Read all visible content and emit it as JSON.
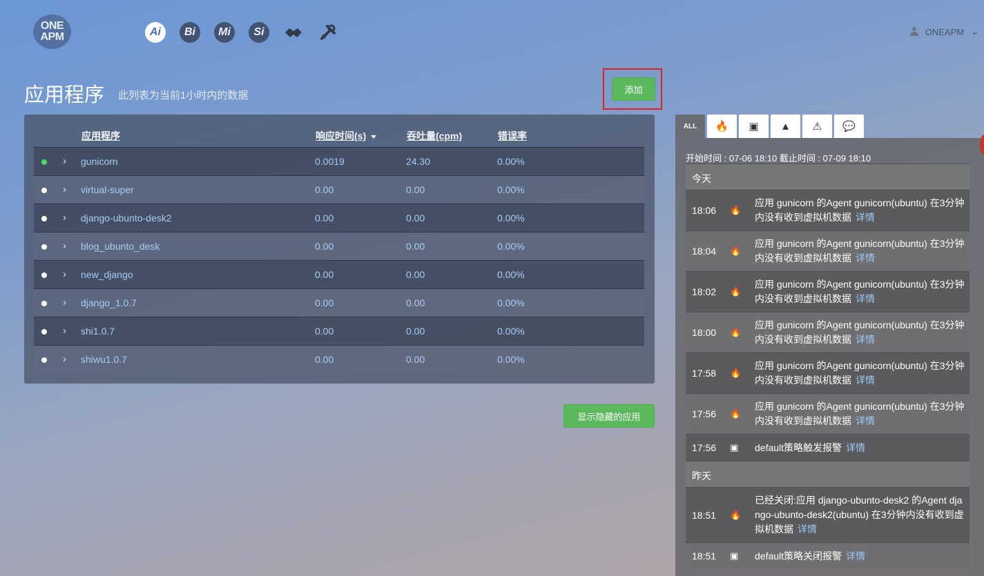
{
  "nav": {
    "logo_line1": "ONE",
    "logo_line2": "APM",
    "products": [
      {
        "label": "Ai",
        "icon": "ai-icon"
      },
      {
        "label": "Bi",
        "icon": "bi-icon"
      },
      {
        "label": "Mi",
        "icon": "mi-icon"
      },
      {
        "label": "Si",
        "icon": "si-icon"
      }
    ],
    "user_name": "ONEAPM"
  },
  "page": {
    "title": "应用程序",
    "subtitle": "此列表为当前1小时内的数据",
    "add_button": "添加",
    "show_hidden_button": "显示隐藏的应用"
  },
  "table": {
    "headers": {
      "name": "应用程序",
      "response": "响应时间(s)",
      "throughput": "吞吐量(cpm)",
      "error": "错误率"
    },
    "rows": [
      {
        "name": "gunicorn",
        "response": "0.0019",
        "throughput": "24.30",
        "error": "0.00%",
        "status": "green"
      },
      {
        "name": "virtual-super",
        "response": "0.00",
        "throughput": "0.00",
        "error": "0.00%",
        "status": "white"
      },
      {
        "name": "django-ubunto-desk2",
        "response": "0.00",
        "throughput": "0.00",
        "error": "0.00%",
        "status": "white"
      },
      {
        "name": "blog_ubunto_desk",
        "response": "0.00",
        "throughput": "0.00",
        "error": "0.00%",
        "status": "white"
      },
      {
        "name": "new_django",
        "response": "0.00",
        "throughput": "0.00",
        "error": "0.00%",
        "status": "white"
      },
      {
        "name": "django_1.0.7",
        "response": "0.00",
        "throughput": "0.00",
        "error": "0.00%",
        "status": "white"
      },
      {
        "name": "shi1.0.7",
        "response": "0.00",
        "throughput": "0.00",
        "error": "0.00%",
        "status": "white"
      },
      {
        "name": "shiwu1.0.7",
        "response": "0.00",
        "throughput": "0.00",
        "error": "0.00%",
        "status": "white"
      }
    ]
  },
  "alerts": {
    "tabs": [
      "ALL"
    ],
    "range_text": "开始时间 : 07-06 18:10 截止时间 : 07-09 18:10",
    "today_label": "今天",
    "yesterday_label": "昨天",
    "detail_label": "详情",
    "today": [
      {
        "time": "18:06",
        "icon": "fire-icon",
        "message": "应用 gunicorn 的Agent gunicorn(ubuntu) 在3分钟内没有收到虚拟机数据"
      },
      {
        "time": "18:04",
        "icon": "fire-icon",
        "message": "应用 gunicorn 的Agent gunicorn(ubuntu) 在3分钟内没有收到虚拟机数据"
      },
      {
        "time": "18:02",
        "icon": "fire-icon",
        "message": "应用 gunicorn 的Agent gunicorn(ubuntu) 在3分钟内没有收到虚拟机数据"
      },
      {
        "time": "18:00",
        "icon": "fire-icon",
        "message": "应用 gunicorn 的Agent gunicorn(ubuntu) 在3分钟内没有收到虚拟机数据"
      },
      {
        "time": "17:58",
        "icon": "fire-icon",
        "message": "应用 gunicorn 的Agent gunicorn(ubuntu) 在3分钟内没有收到虚拟机数据"
      },
      {
        "time": "17:56",
        "icon": "fire-icon",
        "message": "应用 gunicorn 的Agent gunicorn(ubuntu) 在3分钟内没有收到虚拟机数据"
      },
      {
        "time": "17:56",
        "icon": "inbox-icon",
        "message": "default策略触发报警"
      }
    ],
    "yesterday": [
      {
        "time": "18:51",
        "icon": "fire-icon",
        "message": "已经关闭:应用 django-ubunto-desk2 的Agent django-ubunto-desk2(ubuntu) 在3分钟内没有收到虚拟机数据"
      },
      {
        "time": "18:51",
        "icon": "inbox-icon",
        "message": "default策略关闭报警"
      }
    ]
  },
  "colors": {
    "accent_green": "#5cb85c",
    "highlight_red": "#e02020",
    "link_blue": "#9cc8f5"
  }
}
